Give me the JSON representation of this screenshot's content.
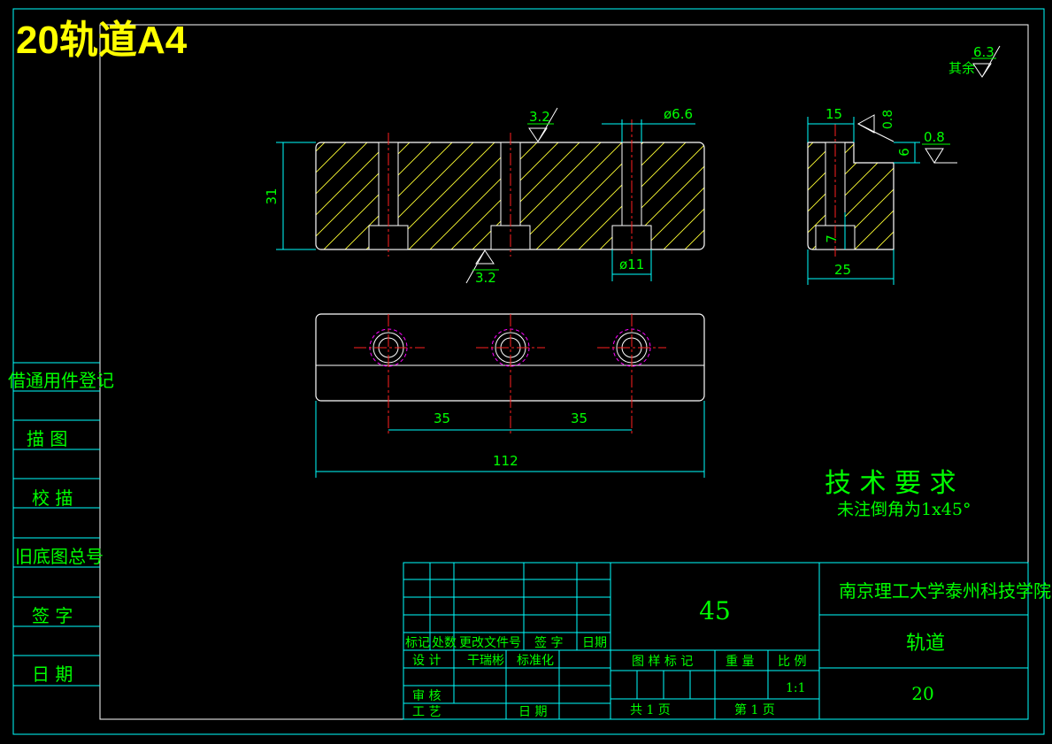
{
  "header": {
    "title": "20轨道A4"
  },
  "roughness": {
    "general_label": "其余",
    "general_value": "6.3",
    "top_value": "3.2",
    "bottom_value": "3.2",
    "side_top_value": "0.8",
    "side_right_value": "0.8"
  },
  "dimensions": {
    "height_31": "31",
    "hole_small": "ø6.6",
    "hole_large": "ø11",
    "side_width_15": "15",
    "side_step_6": "6",
    "side_depth_7": "7",
    "side_total_25": "25",
    "pitch_a": "35",
    "pitch_b": "35",
    "length_112": "112"
  },
  "tech_requirements": {
    "heading": "技 术 要 求",
    "note": "未注倒角为1x45°"
  },
  "left_column": {
    "items": [
      "借通用件登记",
      "描   图",
      "校   描",
      "旧底图总号",
      "签   字",
      "日   期"
    ]
  },
  "title_block": {
    "material": "45",
    "school": "南京理工大学泰州科技学院",
    "part_name": "轨道",
    "drawing_no": "20",
    "row_headers": [
      "标记",
      "处数",
      "更改文件号",
      "签  字",
      "日期"
    ],
    "design_label": "设  计",
    "designer": "干瑞彬",
    "standardize_label": "标准化",
    "review_label": "审  核",
    "process_label": "工  艺",
    "date_label": "日  期",
    "col_labels": [
      "图 样 标 记",
      "重 量",
      "比 例"
    ],
    "scale": "1:1",
    "total_pages": "共    1    页",
    "page_no": "第    1    页"
  }
}
